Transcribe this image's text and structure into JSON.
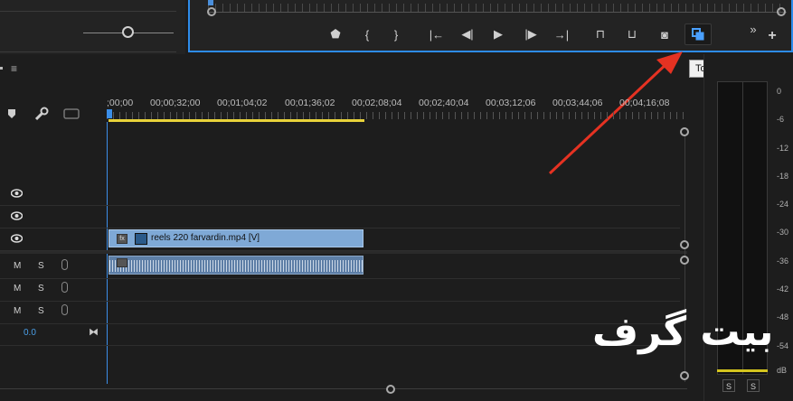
{
  "source_panel": {},
  "program_monitor": {
    "transport": [
      {
        "name": "add-marker",
        "glyph": "⬟"
      },
      {
        "name": "mark-in",
        "glyph": "{"
      },
      {
        "name": "mark-out",
        "glyph": "}"
      },
      {
        "name": "go-to-in",
        "glyph": "|←"
      },
      {
        "name": "step-back",
        "glyph": "◀|"
      },
      {
        "name": "play",
        "glyph": "▶"
      },
      {
        "name": "step-forward",
        "glyph": "|▶"
      },
      {
        "name": "go-to-out",
        "glyph": "→|"
      },
      {
        "name": "lift",
        "glyph": "⊓"
      },
      {
        "name": "extract",
        "glyph": "⊔"
      },
      {
        "name": "export-frame",
        "glyph": "◙"
      },
      {
        "name": "toggle-proxies",
        "glyph": "⟲"
      }
    ],
    "more_glyph": "»",
    "add_glyph": "+"
  },
  "tooltip": {
    "text": "Toggle Proxies"
  },
  "timeline": {
    "menu_glyph": "≡",
    "timecodes": [
      ";00;00",
      "00;00;32;00",
      "00;01;04;02",
      "00;01;36;02",
      "00;02;08;04",
      "00;02;40;04",
      "00;03;12;06",
      "00;03;44;06",
      "00;04;16;08"
    ],
    "master_value": "0.0",
    "tracks_ms": {
      "m": "M",
      "s": "S"
    },
    "clip_video_label": "reels 220 farvardin.mp4 [V]",
    "clip_fx_label": "fx"
  },
  "audio_meter": {
    "db_labels": [
      "0",
      "-6",
      "-12",
      "-18",
      "-24",
      "-30",
      "-36",
      "-42",
      "-48",
      "-54",
      "dB"
    ],
    "solo_labels": [
      "S",
      "S"
    ]
  },
  "watermark": {
    "text": "بیت گرف"
  },
  "colors": {
    "accent": "#2d8ceb",
    "clip_video": "#7fa9d6",
    "clip_audio": "#5d7ea6",
    "work_area": "#e8d23a",
    "arrow": "#e53222"
  }
}
